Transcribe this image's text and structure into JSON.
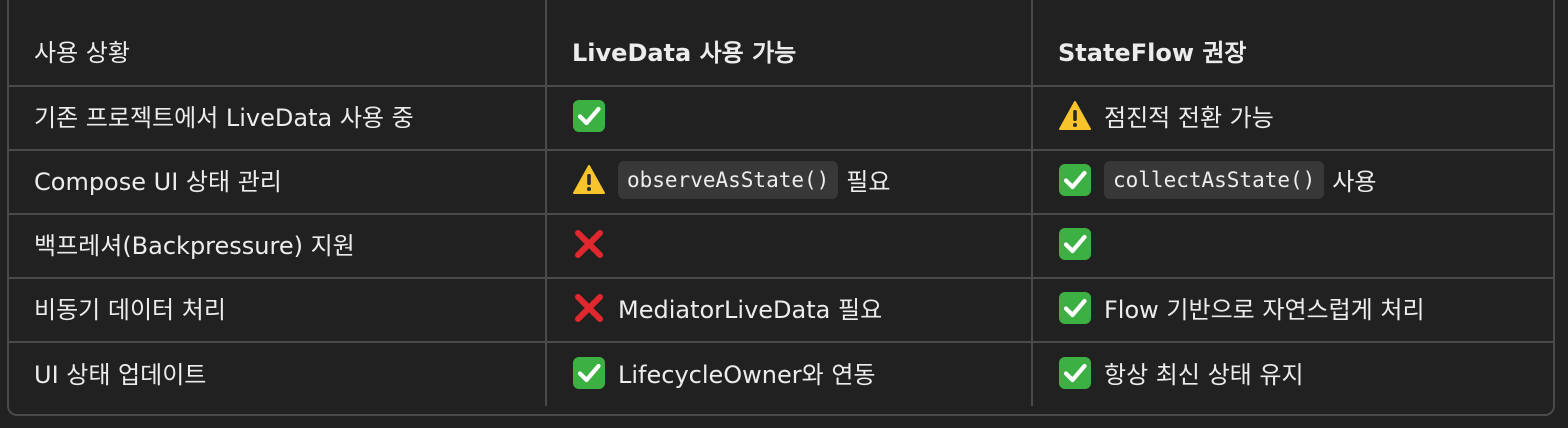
{
  "table": {
    "headers": [
      "사용 상황",
      "LiveData 사용 가능",
      "StateFlow 권장"
    ],
    "rows": [
      {
        "situation": "기존 프로젝트에서 LiveData 사용 중",
        "livedata": {
          "icon": "check-mark-icon",
          "code": "",
          "text": ""
        },
        "stateflow": {
          "icon": "warning-icon",
          "code": "",
          "text": "점진적 전환 가능"
        }
      },
      {
        "situation": "Compose UI 상태 관리",
        "livedata": {
          "icon": "warning-icon",
          "code": "observeAsState()",
          "text": "필요"
        },
        "stateflow": {
          "icon": "check-mark-icon",
          "code": "collectAsState()",
          "text": "사용"
        }
      },
      {
        "situation": "백프레셔(Backpressure) 지원",
        "livedata": {
          "icon": "cross-mark-icon",
          "code": "",
          "text": ""
        },
        "stateflow": {
          "icon": "check-mark-icon",
          "code": "",
          "text": ""
        }
      },
      {
        "situation": "비동기 데이터 처리",
        "livedata": {
          "icon": "cross-mark-icon",
          "code": "",
          "text": "MediatorLiveData 필요"
        },
        "stateflow": {
          "icon": "check-mark-icon",
          "code": "",
          "text": "Flow 기반으로 자연스럽게 처리"
        }
      },
      {
        "situation": "UI 상태 업데이트",
        "livedata": {
          "icon": "check-mark-icon",
          "code": "",
          "text": "LifecycleOwner와 연동"
        },
        "stateflow": {
          "icon": "check-mark-icon",
          "code": "",
          "text": "항상 최신 상태 유지"
        }
      }
    ]
  },
  "colors": {
    "background": "#212121",
    "text": "#ececec",
    "border": "#4a4a4a",
    "code_bg": "#383838",
    "check_green": "#3cb043",
    "warning_yellow": "#f7c52b",
    "cross_red": "#e0282e"
  }
}
